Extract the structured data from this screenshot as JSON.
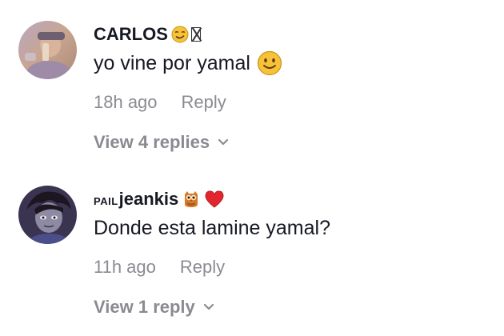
{
  "comments": [
    {
      "username": "CARLOS",
      "username_prefix": "",
      "username_emojis": [
        "smirk-emoji-icon",
        "missing-glyph-box"
      ],
      "text": "yo vine por yamal",
      "text_emoji": "slight-smile-emoji-icon",
      "time": "18h ago",
      "reply_label": "Reply",
      "view_replies": "View 4 replies",
      "avatar": "user-avatar-photo"
    },
    {
      "username": "jeankis",
      "username_prefix": "PAIL",
      "username_emojis": [
        "owl-emoji-icon",
        "red-heart-emoji-icon"
      ],
      "text": "Donde esta lamine yamal?",
      "text_emoji": "",
      "time": "11h ago",
      "reply_label": "Reply",
      "view_replies": "View 1 reply",
      "avatar": "cartoon-avatar"
    }
  ],
  "colors": {
    "primary_text": "#161823",
    "secondary_text": "#8a8b91",
    "heart": "#e3262e",
    "emoji_yellow": "#f7c23a"
  }
}
